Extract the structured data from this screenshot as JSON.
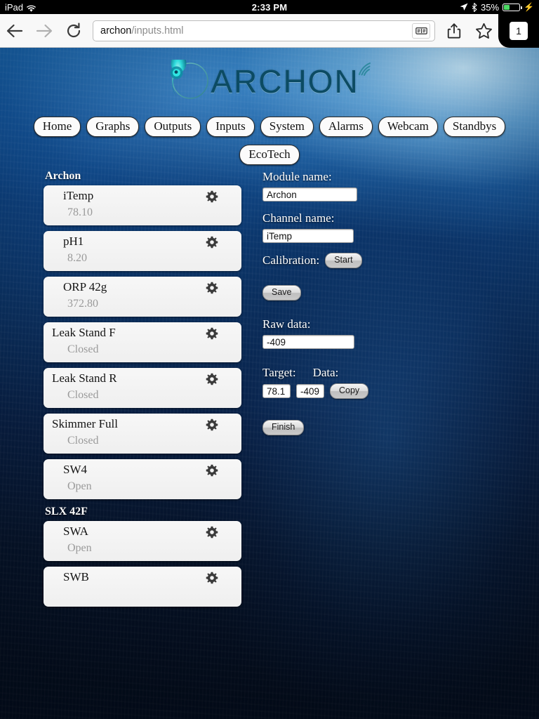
{
  "status_bar": {
    "carrier": "iPad",
    "wifi_icon": "wifi-icon",
    "time": "2:33 PM",
    "location_icon": "location-arrow-icon",
    "bluetooth_icon": "bluetooth-icon",
    "battery_percent": "35%",
    "charging_icon": "lightning-bolt-icon"
  },
  "browser": {
    "back_icon": "back-arrow-icon",
    "forward_icon": "forward-arrow-icon",
    "reload_icon": "reload-icon",
    "url_host": "archon",
    "url_path": "/inputs.html",
    "reader_icon": "reader-view-icon",
    "share_icon": "share-icon",
    "bookmark_icon": "star-icon",
    "tab_count": "1"
  },
  "site": {
    "logo_text": "ARCHON",
    "logo_mark_icon": "archon-swirl-icon",
    "logo_wifi_icon": "signal-waves-icon",
    "nav": [
      {
        "label": "Home"
      },
      {
        "label": "Graphs"
      },
      {
        "label": "Outputs"
      },
      {
        "label": "Inputs"
      },
      {
        "label": "System"
      },
      {
        "label": "Alarms"
      },
      {
        "label": "Webcam"
      },
      {
        "label": "Standbys"
      }
    ],
    "nav_row2": [
      {
        "label": "EcoTech"
      }
    ]
  },
  "channel_groups": [
    {
      "title": "Archon",
      "channels": [
        {
          "name": "iTemp",
          "value": "78.10",
          "indent": true,
          "gear_icon": "gear-icon"
        },
        {
          "name": "pH1",
          "value": "8.20",
          "indent": true,
          "gear_icon": "gear-icon"
        },
        {
          "name": "ORP 42g",
          "value": "372.80",
          "indent": true,
          "gear_icon": "gear-icon"
        },
        {
          "name": "Leak Stand F",
          "value": "Closed",
          "indent": false,
          "gear_icon": "gear-icon"
        },
        {
          "name": "Leak Stand R",
          "value": "Closed",
          "indent": false,
          "gear_icon": "gear-icon"
        },
        {
          "name": "Skimmer Full",
          "value": "Closed",
          "indent": false,
          "gear_icon": "gear-icon"
        },
        {
          "name": "SW4",
          "value": "Open",
          "indent": true,
          "gear_icon": "gear-icon"
        }
      ]
    },
    {
      "title": "SLX 42F",
      "channels": [
        {
          "name": "SWA",
          "value": "Open",
          "indent": true,
          "gear_icon": "gear-icon"
        },
        {
          "name": "SWB",
          "value": "",
          "indent": true,
          "gear_icon": "gear-icon"
        }
      ]
    }
  ],
  "form": {
    "module_name_label": "Module name:",
    "module_name_value": "Archon",
    "channel_name_label": "Channel name:",
    "channel_name_value": "iTemp",
    "calibration_label": "Calibration:",
    "start_button": "Start",
    "save_button": "Save",
    "raw_data_label": "Raw data:",
    "raw_data_value": "-409",
    "target_label": "Target:",
    "data_label": "Data:",
    "target_value": "78.1",
    "data_value": "-409",
    "copy_button": "Copy",
    "finish_button": "Finish"
  },
  "colors": {
    "accent_blue": "#0c3668",
    "logo_teal": "#0c4b63",
    "battery_green": "#4cd964",
    "card_bg": "#f2f2f2",
    "value_gray": "#9a9a9a"
  }
}
